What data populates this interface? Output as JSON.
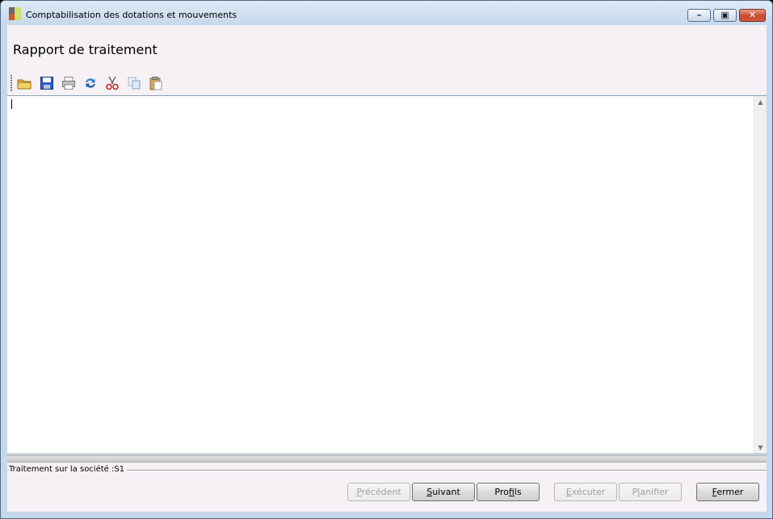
{
  "window": {
    "title": "Comptabilisation des dotations et mouvements",
    "controls": {
      "minimize": "minimize",
      "maximize": "restore",
      "close": "close"
    }
  },
  "page": {
    "title": "Rapport de traitement"
  },
  "toolbar": {
    "items": [
      {
        "name": "open-folder-icon",
        "tooltip": ""
      },
      {
        "name": "save-disk-icon",
        "tooltip": ""
      },
      {
        "name": "print-icon",
        "tooltip": ""
      },
      {
        "name": "refresh-icon",
        "tooltip": ""
      },
      {
        "name": "cut-scissors-icon",
        "tooltip": ""
      },
      {
        "name": "copy-icon",
        "tooltip": ""
      },
      {
        "name": "paste-icon",
        "tooltip": ""
      }
    ]
  },
  "editor": {
    "content": ""
  },
  "status": {
    "text": "Traitement sur la société :S1"
  },
  "buttons": {
    "precedent": {
      "pre": "",
      "u": "P",
      "post": "récédent",
      "enabled": false
    },
    "suivant": {
      "pre": "",
      "u": "S",
      "post": "uivant",
      "enabled": true
    },
    "profils": {
      "pre": "Pro",
      "u": "f",
      "post": "ils",
      "enabled": true
    },
    "executer": {
      "pre": "",
      "u": "E",
      "post": "xécuter",
      "enabled": false
    },
    "planifier": {
      "pre": "P",
      "u": "l",
      "post": "anifier",
      "enabled": false
    },
    "fermer": {
      "pre": "",
      "u": "F",
      "post": "ermer",
      "enabled": true
    }
  },
  "colors": {
    "title_bar": "#c6d8ec",
    "client_bg": "#f5f1f5",
    "close_button": "#c7492e"
  }
}
